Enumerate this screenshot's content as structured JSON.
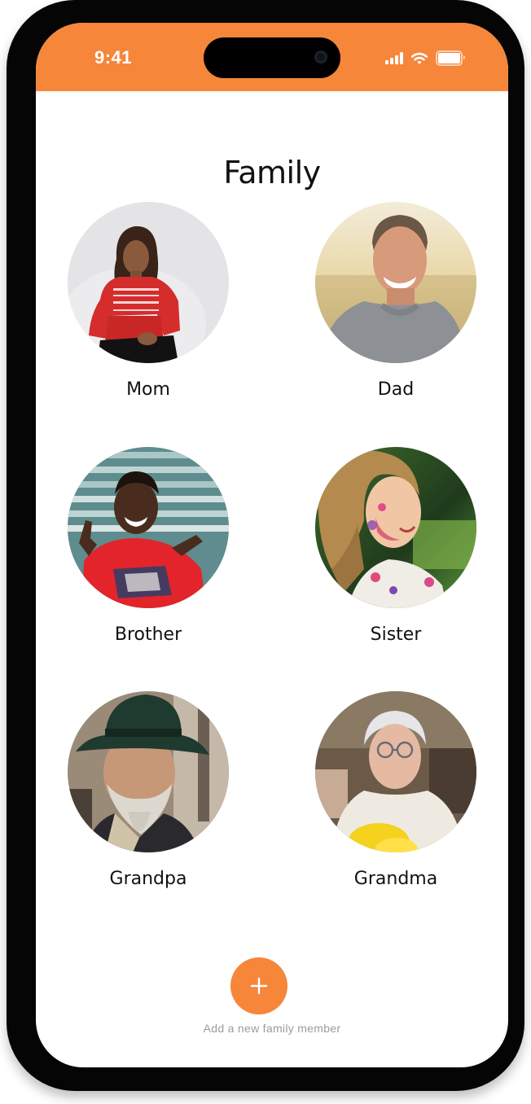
{
  "colors": {
    "accent": "#F5863A"
  },
  "status_bar": {
    "time": "9:41",
    "icons": [
      "signal-icon",
      "wifi-icon",
      "battery-icon"
    ]
  },
  "page": {
    "title": "Family"
  },
  "members": [
    {
      "name": "Mom",
      "photo": "mom-photo"
    },
    {
      "name": "Dad",
      "photo": "dad-photo"
    },
    {
      "name": "Brother",
      "photo": "brother-photo"
    },
    {
      "name": "Sister",
      "photo": "sister-photo"
    },
    {
      "name": "Grandpa",
      "photo": "grandpa-photo"
    },
    {
      "name": "Grandma",
      "photo": "grandma-photo"
    }
  ],
  "add_member": {
    "icon": "plus-icon",
    "label": "Add a new family member"
  }
}
